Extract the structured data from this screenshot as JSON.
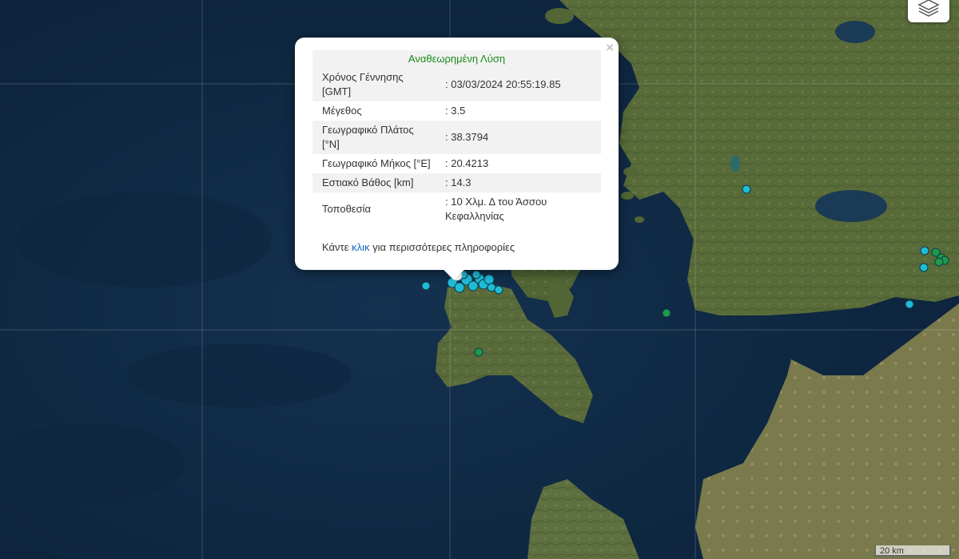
{
  "map": {
    "graticule": true,
    "colors": {
      "sea": "#0f2a45",
      "land": "#5b6e3c",
      "quake_blue": "#1fbcd6",
      "quake_green": "#1f9a4a"
    },
    "layers_icon": "layers-icon",
    "scale_label": "20 km"
  },
  "popup": {
    "title": "Αναθεωρημένη Λύση",
    "close_label": "×",
    "rows": [
      {
        "label": "Χρόνος Γέννησης [GMT]",
        "value": ": 03/03/2024 20:55:19.85"
      },
      {
        "label": "Μέγεθος",
        "value": ": 3.5"
      },
      {
        "label": "Γεωγραφικό Πλάτος [°N]",
        "value": ": 38.3794"
      },
      {
        "label": "Γεωγραφικό Μήκος [°E]",
        "value": ": 20.4213"
      },
      {
        "label": "Εστιακό Βάθος [km]",
        "value": ": 14.3"
      },
      {
        "label": "Τοποθεσία",
        "value": ": 10 Χλμ. Δ του Άσσου Κεφαλληνίας"
      }
    ],
    "more_prefix": "Κάντε",
    "more_link": "κλικ",
    "more_suffix": "για περισσότερες πληροφορίες"
  }
}
